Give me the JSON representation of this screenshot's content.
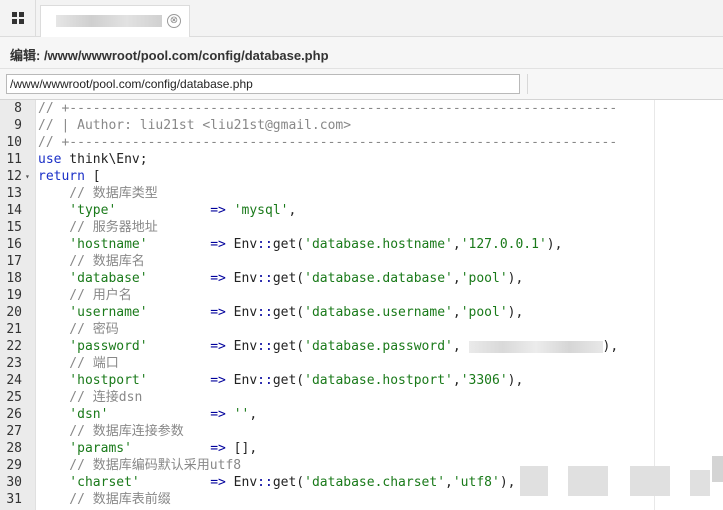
{
  "tab": {
    "close_glyph": "⊗"
  },
  "header": {
    "title": "编辑: /www/wwwroot/pool.com/config/database.php"
  },
  "pathbar": {
    "value": "/www/wwwroot/pool.com/config/database.php"
  },
  "editor": {
    "lines": [
      {
        "n": "8",
        "fold": "",
        "parts": [
          {
            "t": "// +----------------------------------------------------------------------",
            "c": "comment"
          }
        ]
      },
      {
        "n": "9",
        "fold": "",
        "parts": [
          {
            "t": "// | Author: liu21st <liu21st@gmail.com>",
            "c": "comment"
          }
        ]
      },
      {
        "n": "10",
        "fold": "",
        "parts": [
          {
            "t": "// +----------------------------------------------------------------------",
            "c": "comment"
          }
        ]
      },
      {
        "n": "11",
        "fold": "",
        "parts": [
          {
            "t": "use",
            "c": "kw"
          },
          {
            "t": " think\\Env;",
            "c": "plain"
          }
        ]
      },
      {
        "n": "12",
        "fold": "▾",
        "parts": [
          {
            "t": "return",
            "c": "kw"
          },
          {
            "t": " [",
            "c": "plain"
          }
        ]
      },
      {
        "n": "13",
        "fold": "",
        "parts": [
          {
            "t": "    // 数据库类型",
            "c": "comment"
          }
        ]
      },
      {
        "n": "14",
        "fold": "",
        "parts": [
          {
            "t": "    'type'",
            "c": "str"
          },
          {
            "t": "            ",
            "c": "plain"
          },
          {
            "t": "=>",
            "c": "op"
          },
          {
            "t": " ",
            "c": "plain"
          },
          {
            "t": "'mysql'",
            "c": "str"
          },
          {
            "t": ",",
            "c": "plain"
          }
        ]
      },
      {
        "n": "15",
        "fold": "",
        "parts": [
          {
            "t": "    // 服务器地址",
            "c": "comment"
          }
        ]
      },
      {
        "n": "16",
        "fold": "",
        "parts": [
          {
            "t": "    'hostname'",
            "c": "str"
          },
          {
            "t": "        ",
            "c": "plain"
          },
          {
            "t": "=>",
            "c": "op"
          },
          {
            "t": " Env",
            "c": "plain"
          },
          {
            "t": "::",
            "c": "op"
          },
          {
            "t": "get(",
            "c": "plain"
          },
          {
            "t": "'database.hostname'",
            "c": "str"
          },
          {
            "t": ",",
            "c": "plain"
          },
          {
            "t": "'127.0.0.1'",
            "c": "str"
          },
          {
            "t": "),",
            "c": "plain"
          }
        ]
      },
      {
        "n": "17",
        "fold": "",
        "parts": [
          {
            "t": "    // 数据库名",
            "c": "comment"
          }
        ]
      },
      {
        "n": "18",
        "fold": "",
        "parts": [
          {
            "t": "    'database'",
            "c": "str"
          },
          {
            "t": "        ",
            "c": "plain"
          },
          {
            "t": "=>",
            "c": "op"
          },
          {
            "t": " Env",
            "c": "plain"
          },
          {
            "t": "::",
            "c": "op"
          },
          {
            "t": "get(",
            "c": "plain"
          },
          {
            "t": "'database.database'",
            "c": "str"
          },
          {
            "t": ",",
            "c": "plain"
          },
          {
            "t": "'pool'",
            "c": "str"
          },
          {
            "t": "),",
            "c": "plain"
          }
        ]
      },
      {
        "n": "19",
        "fold": "",
        "parts": [
          {
            "t": "    // 用户名",
            "c": "comment"
          }
        ]
      },
      {
        "n": "20",
        "fold": "",
        "parts": [
          {
            "t": "    'username'",
            "c": "str"
          },
          {
            "t": "        ",
            "c": "plain"
          },
          {
            "t": "=>",
            "c": "op"
          },
          {
            "t": " Env",
            "c": "plain"
          },
          {
            "t": "::",
            "c": "op"
          },
          {
            "t": "get(",
            "c": "plain"
          },
          {
            "t": "'database.username'",
            "c": "str"
          },
          {
            "t": ",",
            "c": "plain"
          },
          {
            "t": "'pool'",
            "c": "str"
          },
          {
            "t": "),",
            "c": "plain"
          }
        ]
      },
      {
        "n": "21",
        "fold": "",
        "parts": [
          {
            "t": "    // 密码",
            "c": "comment"
          }
        ]
      },
      {
        "n": "22",
        "fold": "",
        "parts": [
          {
            "t": "    'password'",
            "c": "str"
          },
          {
            "t": "        ",
            "c": "plain"
          },
          {
            "t": "=>",
            "c": "op"
          },
          {
            "t": " Env",
            "c": "plain"
          },
          {
            "t": "::",
            "c": "op"
          },
          {
            "t": "get(",
            "c": "plain"
          },
          {
            "t": "'database.password'",
            "c": "str"
          },
          {
            "t": ", ",
            "c": "plain"
          },
          {
            "t": "",
            "c": "redact"
          },
          {
            "t": "),",
            "c": "plain"
          }
        ]
      },
      {
        "n": "23",
        "fold": "",
        "parts": [
          {
            "t": "    // 端口",
            "c": "comment"
          }
        ]
      },
      {
        "n": "24",
        "fold": "",
        "parts": [
          {
            "t": "    'hostport'",
            "c": "str"
          },
          {
            "t": "        ",
            "c": "plain"
          },
          {
            "t": "=>",
            "c": "op"
          },
          {
            "t": " Env",
            "c": "plain"
          },
          {
            "t": "::",
            "c": "op"
          },
          {
            "t": "get(",
            "c": "plain"
          },
          {
            "t": "'database.hostport'",
            "c": "str"
          },
          {
            "t": ",",
            "c": "plain"
          },
          {
            "t": "'3306'",
            "c": "str"
          },
          {
            "t": "),",
            "c": "plain"
          }
        ]
      },
      {
        "n": "25",
        "fold": "",
        "parts": [
          {
            "t": "    // 连接dsn",
            "c": "comment"
          }
        ]
      },
      {
        "n": "26",
        "fold": "",
        "parts": [
          {
            "t": "    'dsn'",
            "c": "str"
          },
          {
            "t": "             ",
            "c": "plain"
          },
          {
            "t": "=>",
            "c": "op"
          },
          {
            "t": " ",
            "c": "plain"
          },
          {
            "t": "''",
            "c": "str"
          },
          {
            "t": ",",
            "c": "plain"
          }
        ]
      },
      {
        "n": "27",
        "fold": "",
        "parts": [
          {
            "t": "    // 数据库连接参数",
            "c": "comment"
          }
        ]
      },
      {
        "n": "28",
        "fold": "",
        "parts": [
          {
            "t": "    'params'",
            "c": "str"
          },
          {
            "t": "          ",
            "c": "plain"
          },
          {
            "t": "=>",
            "c": "op"
          },
          {
            "t": " [],",
            "c": "plain"
          }
        ]
      },
      {
        "n": "29",
        "fold": "",
        "parts": [
          {
            "t": "    // 数据库编码默认采用utf8",
            "c": "comment"
          }
        ]
      },
      {
        "n": "30",
        "fold": "",
        "parts": [
          {
            "t": "    'charset'",
            "c": "str"
          },
          {
            "t": "         ",
            "c": "plain"
          },
          {
            "t": "=>",
            "c": "op"
          },
          {
            "t": " Env",
            "c": "plain"
          },
          {
            "t": "::",
            "c": "op"
          },
          {
            "t": "get(",
            "c": "plain"
          },
          {
            "t": "'database.charset'",
            "c": "str"
          },
          {
            "t": ",",
            "c": "plain"
          },
          {
            "t": "'utf8'",
            "c": "str"
          },
          {
            "t": "),",
            "c": "plain"
          }
        ]
      },
      {
        "n": "31",
        "fold": "",
        "parts": [
          {
            "t": "    // 数据库表前缀",
            "c": "comment"
          }
        ]
      }
    ]
  }
}
